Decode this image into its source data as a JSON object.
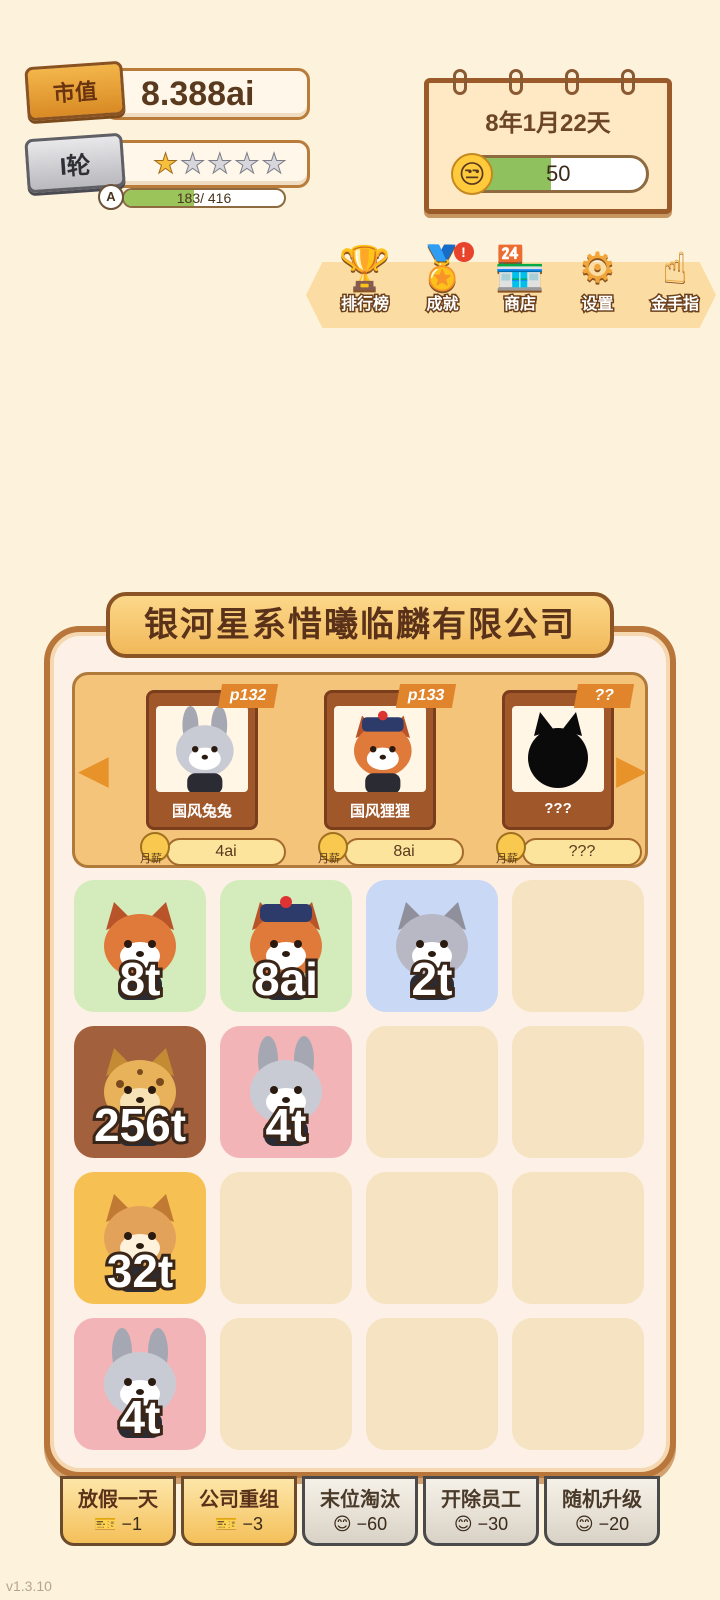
{
  "stats": {
    "market_value_label": "市值",
    "market_value": "8.388ai",
    "round_label": "I轮",
    "stars_filled": 1,
    "stars_total": 5,
    "grade": "A",
    "xp_current": 183,
    "xp_max": 416,
    "xp_text": "183/ 416"
  },
  "calendar": {
    "date": "8年1月22天",
    "mood_value": "50",
    "mood_fraction": 0.5
  },
  "menu": [
    {
      "label": "排行榜",
      "icon": "trophy-icon",
      "glyph": "🏆"
    },
    {
      "label": "成就",
      "icon": "medal-icon",
      "glyph": "🏅",
      "badge": "!"
    },
    {
      "label": "商店",
      "icon": "shop-icon",
      "glyph": "🏪"
    },
    {
      "label": "设置",
      "icon": "gear-icon",
      "glyph": "⚙"
    },
    {
      "label": "金手指",
      "icon": "pointing-hand-icon",
      "glyph": "☝"
    }
  ],
  "company": {
    "name": "银河星系惜曦临麟有限公司"
  },
  "profiles": [
    {
      "tag": "p132",
      "name": "国风兔兔",
      "salary": "4ai",
      "salary_label": "月薪",
      "portrait": "rabbit"
    },
    {
      "tag": "p133",
      "name": "国风狸狸",
      "salary": "8ai",
      "salary_label": "月薪",
      "portrait": "redpanda"
    },
    {
      "tag": "??",
      "name": "???",
      "salary": "???",
      "salary_label": "月薪",
      "portrait": "unknown"
    }
  ],
  "grid": {
    "rows": [
      [
        {
          "level": "8t",
          "animal": "red-panda",
          "bg": "#d4ecbc"
        },
        {
          "level": "8ai",
          "animal": "red-panda-official",
          "bg": "#d4ecbc"
        },
        {
          "level": "2t",
          "animal": "hamster",
          "bg": "#c9d8f4"
        },
        null
      ],
      [
        {
          "level": "256t",
          "animal": "leopard",
          "bg": "#a3603c"
        },
        {
          "level": "4t",
          "animal": "rabbit",
          "bg": "#f3b4b8"
        },
        null,
        null
      ],
      [
        {
          "level": "32t",
          "animal": "shiba",
          "bg": "#f6c152"
        },
        null,
        null,
        null
      ],
      [
        {
          "level": "4t",
          "animal": "rabbit",
          "bg": "#f3b4b8"
        },
        null,
        null,
        null
      ]
    ]
  },
  "actions": [
    {
      "label": "放假一天",
      "cost": "−1",
      "cost_icon": "ticket-icon",
      "style": "gold"
    },
    {
      "label": "公司重组",
      "cost": "−3",
      "cost_icon": "ticket-icon",
      "style": "gold"
    },
    {
      "label": "末位淘汰",
      "cost": "−60",
      "cost_icon": "smile-icon",
      "style": "grey"
    },
    {
      "label": "开除员工",
      "cost": "−30",
      "cost_icon": "smile-icon",
      "style": "grey"
    },
    {
      "label": "随机升级",
      "cost": "−20",
      "cost_icon": "smile-icon",
      "style": "grey"
    }
  ],
  "version": "v1.3.10"
}
